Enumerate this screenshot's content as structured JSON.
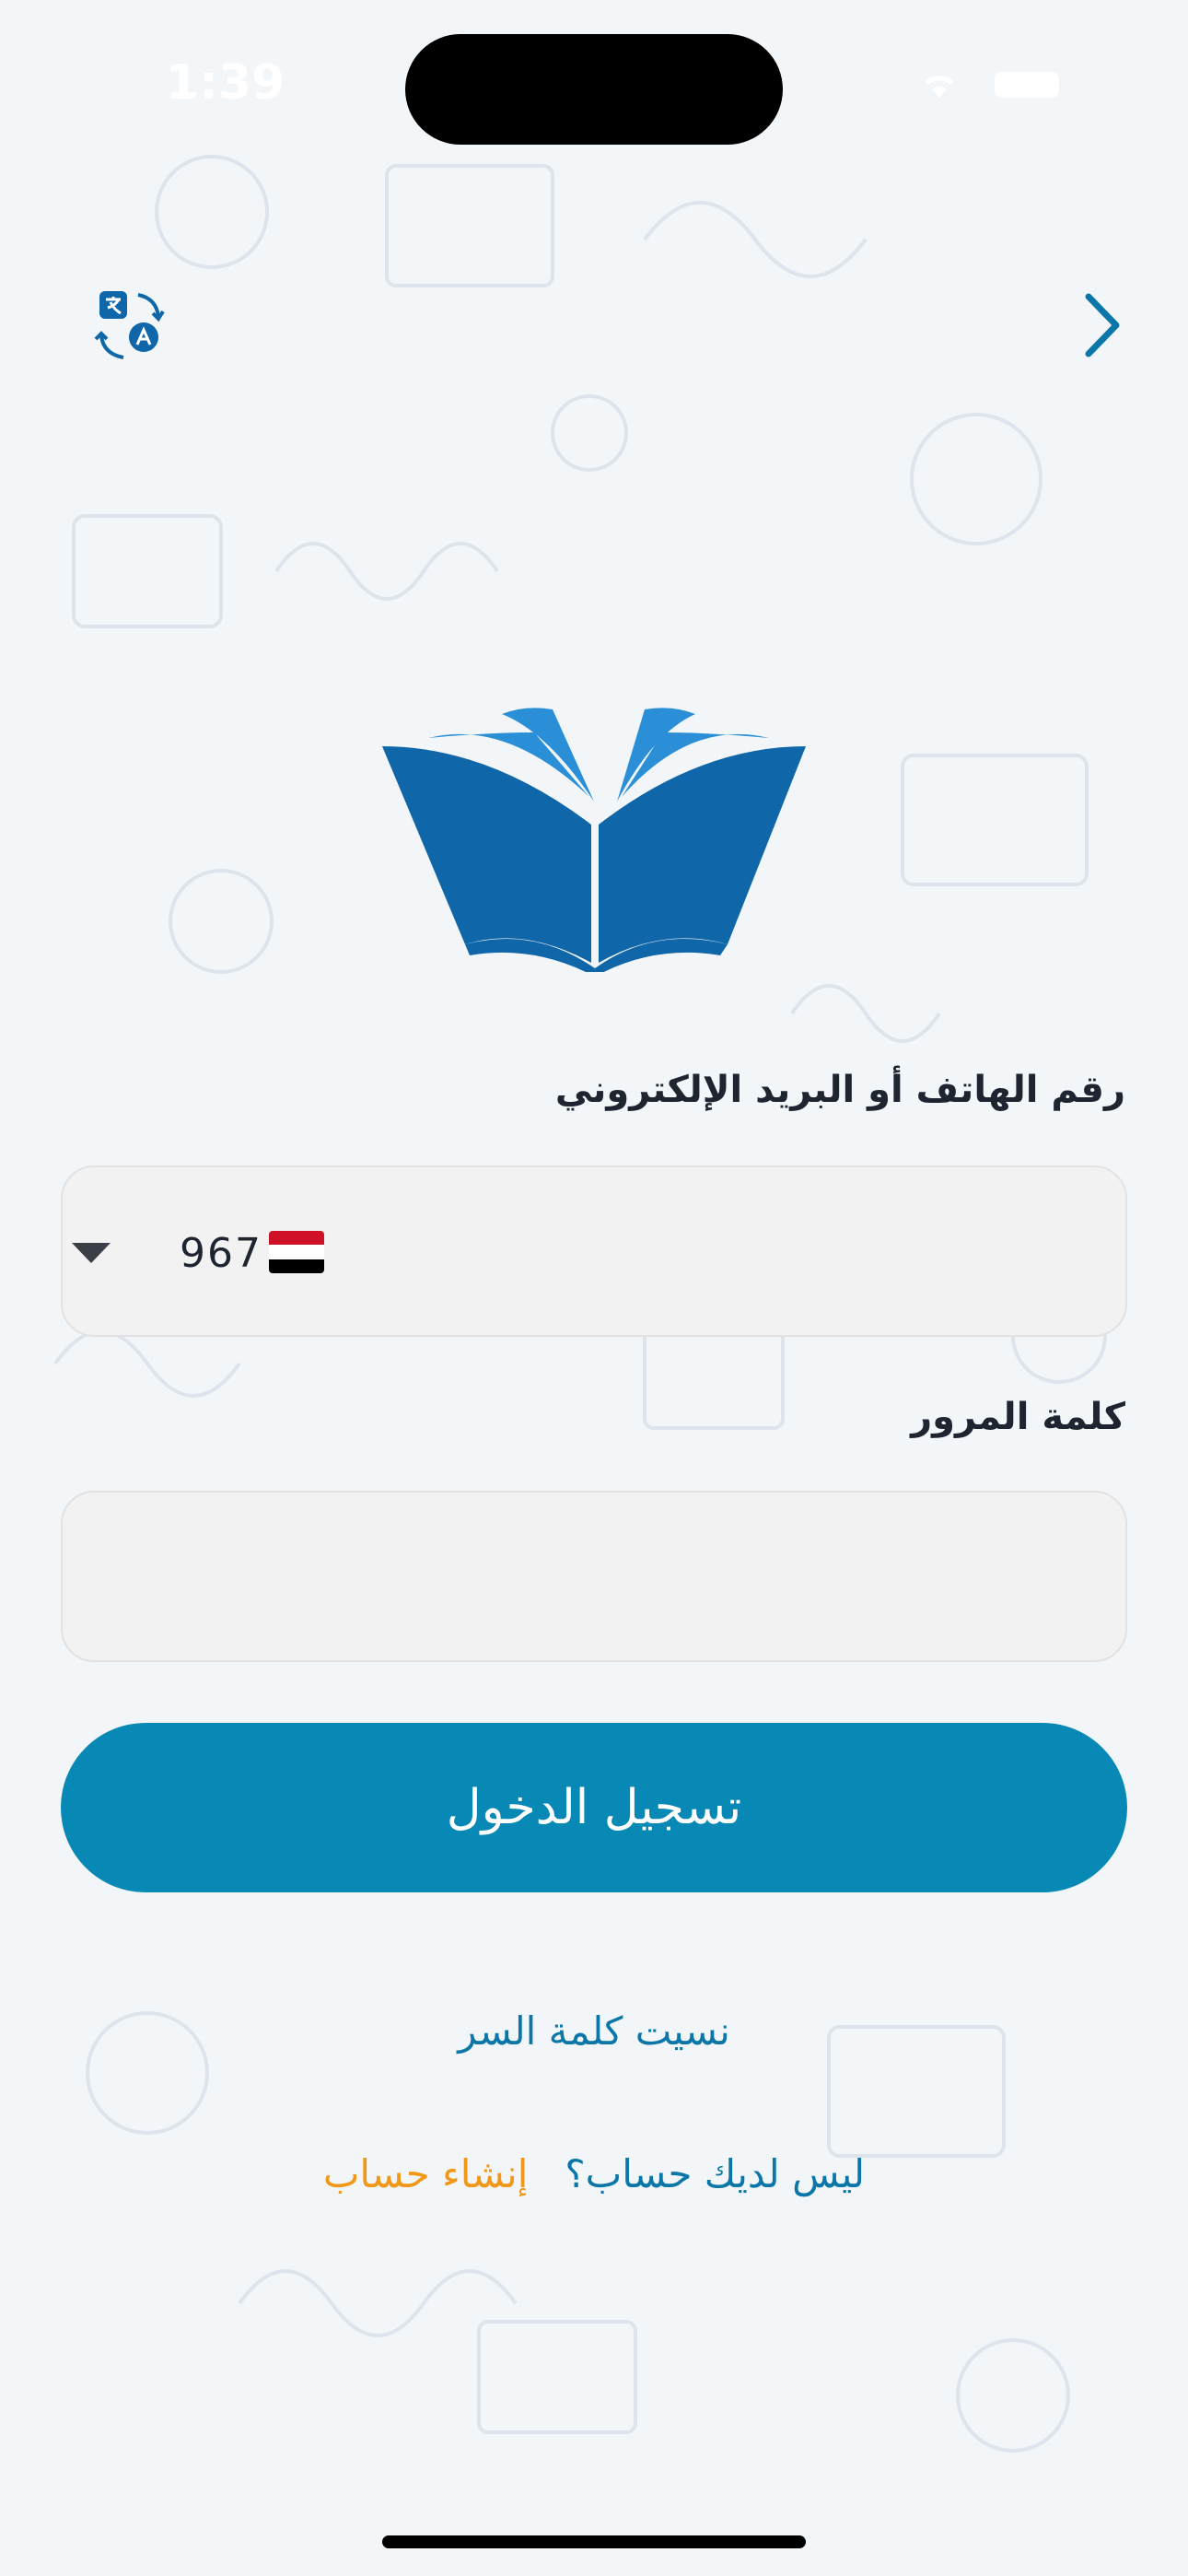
{
  "status_bar": {
    "time": "1:39"
  },
  "header": {
    "translate_icon": "translate-icon",
    "back_icon": "chevron-right-icon"
  },
  "logo": {
    "icon": "open-book-logo"
  },
  "form": {
    "phone_label": "رقم الهاتف أو البريد الإلكتروني",
    "country_code": "967",
    "country_flag": "yemen-flag",
    "password_label": "كلمة المرور",
    "password_value": ""
  },
  "actions": {
    "login_label": "تسجيل الدخول",
    "forgot_password": "نسيت كلمة السر",
    "no_account": "ليس لديك حساب؟",
    "create_account": "إنشاء حساب"
  },
  "colors": {
    "primary": "#0788b5",
    "link": "#0b77a8",
    "accent": "#f0981a",
    "logo_dark": "#0f66a8",
    "logo_light": "#2a8fd6",
    "background": "#f3f6f9"
  }
}
